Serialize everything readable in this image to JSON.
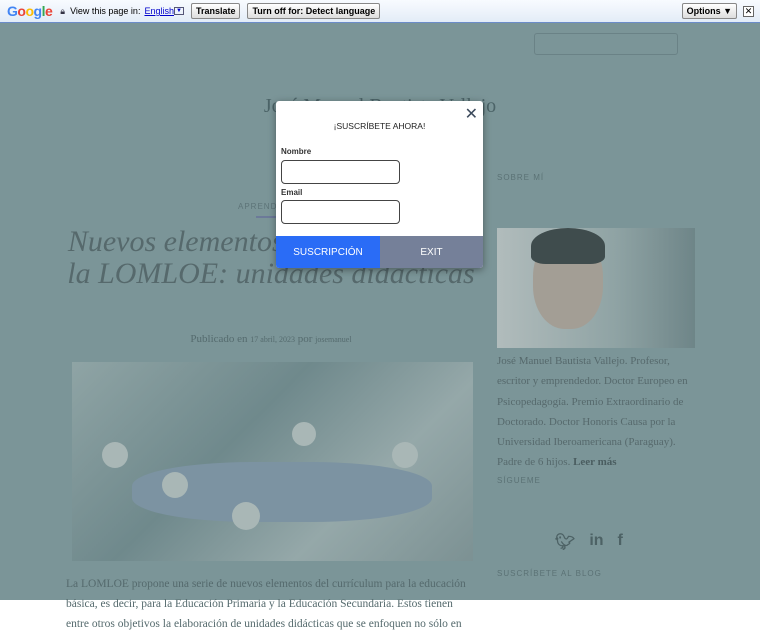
{
  "translate_bar": {
    "logo": "Google",
    "prompt": "View this page in:",
    "language": "English",
    "translate": "Translate",
    "turn_off": "Turn off for: Detect language",
    "options": "Options ▼",
    "close": "✕"
  },
  "site": {
    "title": "José Manuel Bautista Vallejo"
  },
  "post": {
    "category": "APRENDIZAJE",
    "title": "Nuevos elementos curriculares de la LOMLOE: unidades didácticas",
    "meta_prefix": "Publicado en",
    "date": "17 abril, 2023",
    "by": "por",
    "author": "josemanuel",
    "excerpt": "La LOMLOE propone una serie de nuevos elementos del currículum para la educación básica, es decir, para la Educación Primaria y la Educación Secundaria. Estos tienen entre otros objetivos la elaboración de unidades didácticas que se enfoquen no sólo en"
  },
  "sidebar": {
    "about_heading": "SOBRE MÍ",
    "bio": "José Manuel Bautista Vallejo. Profesor, escritor y emprendedor. Doctor Europeo en Psicopedagogía. Premio Extraordinario de Doctorado. Doctor Honoris Causa por la Universidad Iberoamericana (Paraguay). Padre de 6 hijos.",
    "read_more": "Leer más",
    "follow_heading": "SÍGUEME",
    "subscribe_heading": "SUSCRÍBETE AL BLOG",
    "social": [
      "twitter",
      "linkedin",
      "facebook"
    ]
  },
  "modal": {
    "title": "¡SUSCRÍBETE AHORA!",
    "name_label": "Nombre",
    "email_label": "Email",
    "subscribe": "SUSCRIPCIÓN",
    "exit": "EXIT",
    "close": "✕"
  }
}
